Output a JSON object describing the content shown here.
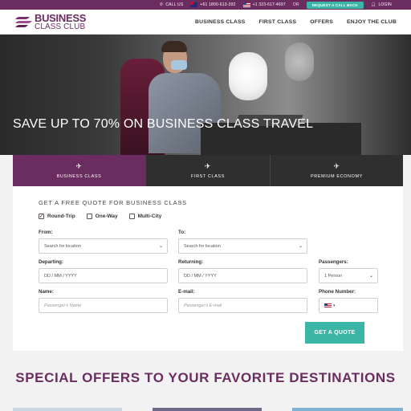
{
  "topbar": {
    "call_label": "CALL US",
    "phone_au": "+61 1800-613-392",
    "phone_us": "+1 323-617-4697",
    "or_label": "OR",
    "callback_label": "REQUEST A CALL BACK",
    "login_label": "LOGIN"
  },
  "logo": {
    "line1": "BUSINESS",
    "line2": "CLASS CLUB"
  },
  "nav": [
    "BUSINESS CLASS",
    "FIRST CLASS",
    "OFFERS",
    "ENJOY THE CLUB"
  ],
  "hero": {
    "title": "SAVE UP TO 70% ON BUSINESS CLASS TRAVEL"
  },
  "tabs": [
    {
      "label": "BUSINESS CLASS",
      "active": true
    },
    {
      "label": "FIRST CLASS",
      "active": false
    },
    {
      "label": "PREMIUM ECONOMY",
      "active": false
    }
  ],
  "form": {
    "title": "GET A FREE QUOTE FOR BUSINESS CLASS",
    "trip_options": [
      {
        "label": "Round-Trip",
        "checked": true
      },
      {
        "label": "One-Way",
        "checked": false
      },
      {
        "label": "Multi-City",
        "checked": false
      }
    ],
    "from": {
      "label": "From:",
      "placeholder": "Search for location"
    },
    "to": {
      "label": "To:",
      "placeholder": "Search for location"
    },
    "departing": {
      "label": "Departing:",
      "placeholder": "DD / MM / YYYY"
    },
    "returning": {
      "label": "Returning:",
      "placeholder": "DD / MM / YYYY"
    },
    "passengers": {
      "label": "Passengers:",
      "value": "1 Person"
    },
    "name": {
      "label": "Name:",
      "placeholder": "Passenger's Name"
    },
    "email": {
      "label": "E-mail:",
      "placeholder": "Passenger's E-mail"
    },
    "phone": {
      "label": "Phone Number:"
    },
    "submit_label": "GET A QUOTE"
  },
  "offers": {
    "title": "SPECIAL OFFERS TO YOUR FAVORITE DESTINATIONS"
  },
  "colors": {
    "brand": "#6b2c5f",
    "accent": "#3bb6a6",
    "dark_tab": "#2f2f2f"
  }
}
